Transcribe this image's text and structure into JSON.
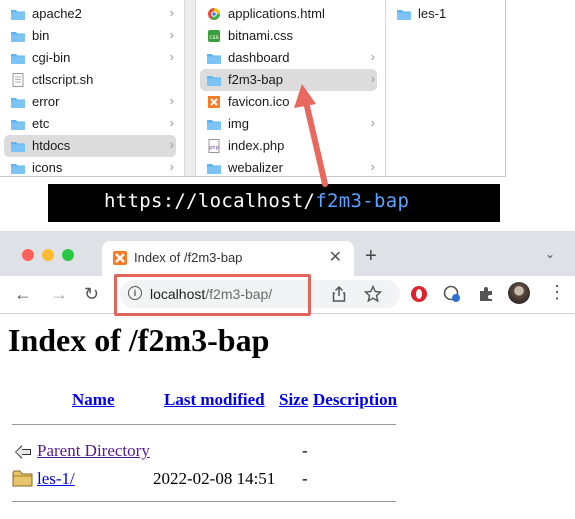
{
  "finder": {
    "column1": [
      {
        "label": "apache2",
        "icon": "folder-icon",
        "chevron": "›"
      },
      {
        "label": "bin",
        "icon": "folder-icon",
        "chevron": "›"
      },
      {
        "label": "cgi-bin",
        "icon": "folder-icon",
        "chevron": "›"
      },
      {
        "label": "ctlscript.sh",
        "icon": "script-file-icon",
        "chevron": ""
      },
      {
        "label": "error",
        "icon": "folder-icon",
        "chevron": "›"
      },
      {
        "label": "etc",
        "icon": "folder-icon",
        "chevron": "›"
      },
      {
        "label": "htdocs",
        "icon": "folder-icon",
        "chevron": "›",
        "selected": true
      },
      {
        "label": "icons",
        "icon": "folder-icon",
        "chevron": "›"
      }
    ],
    "column2": [
      {
        "label": "applications.html",
        "icon": "html-file-icon",
        "chevron": ""
      },
      {
        "label": "bitnami.css",
        "icon": "css-file-icon",
        "chevron": ""
      },
      {
        "label": "dashboard",
        "icon": "folder-icon",
        "chevron": "›"
      },
      {
        "label": "f2m3-bap",
        "icon": "folder-icon",
        "chevron": "›",
        "selected": true
      },
      {
        "label": "favicon.ico",
        "icon": "ico-file-icon",
        "chevron": ""
      },
      {
        "label": "img",
        "icon": "folder-icon",
        "chevron": "›"
      },
      {
        "label": "index.php",
        "icon": "php-file-icon",
        "chevron": ""
      },
      {
        "label": "webalizer",
        "icon": "folder-icon",
        "chevron": "›"
      }
    ],
    "column3": [
      {
        "label": "les-1",
        "icon": "folder-icon"
      }
    ]
  },
  "url_banner": {
    "prefix": "https://localhost/",
    "highlight": "f2m3-bap"
  },
  "browser": {
    "tab_title": "Index of /f2m3-bap",
    "tab_close": "✕",
    "new_tab": "+",
    "tab_menu": "⌄",
    "back": "←",
    "forward": "→",
    "reload": "↻",
    "address_host": "localhost",
    "address_path": "/f2m3-bap/",
    "info": "i",
    "menu": "⋮"
  },
  "page": {
    "title": "Index of /f2m3-bap",
    "headers": {
      "name": "Name",
      "last_modified": "Last modified",
      "size": "Size",
      "description": "Description"
    },
    "rows": [
      {
        "name": "Parent Directory",
        "modified": "",
        "size": "-",
        "icon": "back-arrow-icon"
      },
      {
        "name": "les-1/",
        "modified": "2022-02-08 14:51",
        "size": "-",
        "icon": "folder-icon"
      }
    ]
  },
  "colors": {
    "accent_folder": "#5eb3f0",
    "highlight_url": "#5aa3ff",
    "annotation_red": "#e0665c",
    "link": "#0000ee",
    "visited": "#551a8b"
  }
}
